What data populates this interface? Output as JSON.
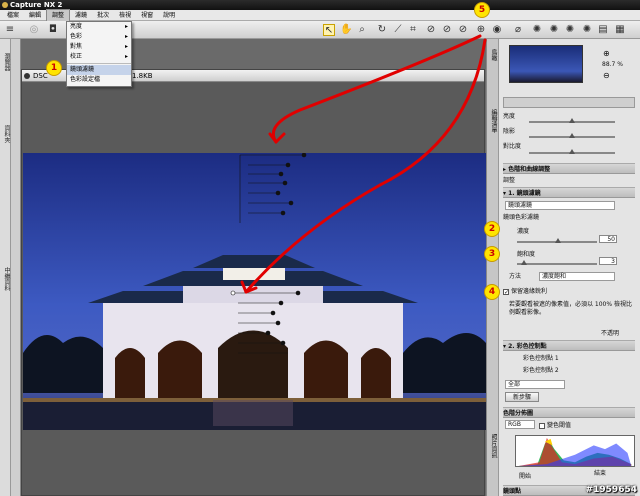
{
  "app": {
    "title": "Capture NX 2"
  },
  "menu": [
    "檔案",
    "編輯",
    "調整",
    "濾鏡",
    "批次",
    "檢視",
    "視窗",
    "說明"
  ],
  "menu_active_index": 2,
  "dropdown": {
    "items": [
      "亮度",
      "色彩",
      "對焦",
      "校正"
    ],
    "items_highlight": "鏡頭濾鏡",
    "items_last": "色彩設定檔"
  },
  "left_tabs": {
    "browser": "瀏覽器",
    "folder": "資料夾",
    "meta": "中繼資料"
  },
  "image_window": {
    "title": "DSC",
    "size": "1.8KB"
  },
  "right_panel": {
    "side_labels": {
      "nav": "鳥瞰",
      "edit": "編輯清單",
      "photo": "照片資訊"
    },
    "zoom": "88.7 %",
    "brightness": "亮度",
    "shadow": "陰影",
    "highlight": "對比度",
    "section_levels": "色階和曲線調整",
    "section_adjust": "調整",
    "section_filter": "1. 鏡頭濾鏡",
    "filter_select": "鏡頭濾鏡",
    "filter_color": "鏡頭色彩濾鏡",
    "density_label": "濃度",
    "density_value": "50",
    "hue_label": "飽和度",
    "hue_value": "3",
    "method_label": "方法",
    "method_value": "濃度飽和",
    "preserve_label": "保留邊緣銳利",
    "preserve_note": "若要觀看被遮的像素值，必須以 100% 檢視比例觀看影像。",
    "opacity_label": "不透明",
    "section_color": "2. 彩色控制點",
    "cp1": "彩色控制點 1",
    "cp2": "彩色控制點 2",
    "all_label": "全部",
    "new_step": "新步驟",
    "histo_section": "色階分佈圖",
    "histo_channel": "RGB",
    "histo_check": "變色閾值",
    "output_label": "開始",
    "output_label2": "結束",
    "bottom_section": "鏡頭點"
  },
  "badges": [
    "5",
    "1",
    "2",
    "3",
    "4"
  ],
  "watermark": "#1959654"
}
